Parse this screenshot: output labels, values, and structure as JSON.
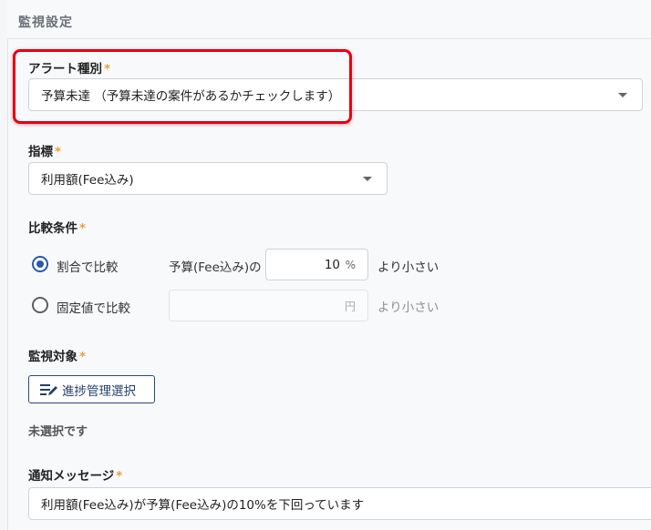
{
  "panel": {
    "title": "監視設定"
  },
  "alert_type": {
    "label": "アラート種別",
    "required_mark": "*",
    "value": "予算未達 （予算未達の案件があるかチェックします）"
  },
  "metric": {
    "label": "指標",
    "required_mark": "*",
    "value": "利用額(Fee込み)"
  },
  "comparison": {
    "label": "比較条件",
    "required_mark": "*",
    "option_ratio": {
      "label": "割合で比較",
      "selected": true,
      "prefix": "予算(Fee込み)の",
      "value": "10",
      "unit": "%",
      "suffix": "より小さい"
    },
    "option_fixed": {
      "label": "固定値で比較",
      "selected": false,
      "value": "",
      "unit": "円",
      "suffix": "より小さい"
    }
  },
  "target": {
    "label": "監視対象",
    "required_mark": "*",
    "button_label": "進捗管理選択",
    "button_icon": "edit-list-icon",
    "status": "未選択です"
  },
  "message": {
    "label": "通知メッセージ",
    "required_mark": "*",
    "value": "利用額(Fee込み)が予算(Fee込み)の10%を下回っています"
  },
  "colors": {
    "highlight": "#e60012",
    "required": "#e8a23a",
    "accent": "#2a5aa7"
  }
}
